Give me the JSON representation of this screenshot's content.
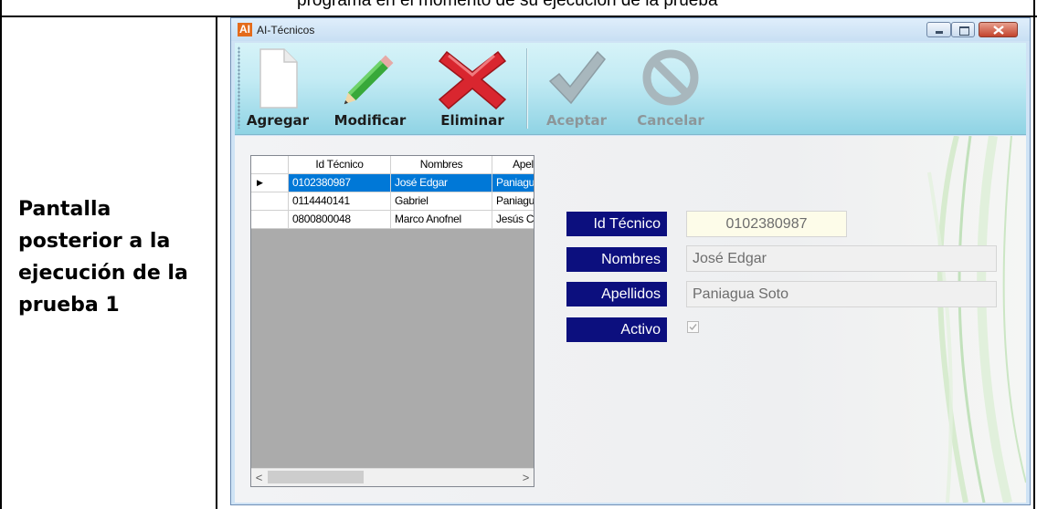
{
  "document": {
    "top_text": "programa en el momento de su ejecución de la prueba",
    "cell_label_lines": [
      "Pantalla",
      "posterior a la",
      "ejecución de la",
      "prueba 1"
    ]
  },
  "window": {
    "icon_text": "AI",
    "title": "AI-Técnicos"
  },
  "toolbar": {
    "items": [
      {
        "label": "Agregar",
        "icon": "new-document-icon",
        "enabled": true
      },
      {
        "label": "Modificar",
        "icon": "pencil-icon",
        "enabled": true
      },
      {
        "label": "Eliminar",
        "icon": "red-x-icon",
        "enabled": true
      },
      {
        "label": "Aceptar",
        "icon": "checkmark-icon",
        "enabled": false
      },
      {
        "label": "Cancelar",
        "icon": "cancel-icon",
        "enabled": false
      }
    ]
  },
  "grid": {
    "columns": [
      "Id Técnico",
      "Nombres",
      "Apellid"
    ],
    "rows": [
      {
        "cells": [
          "0102380987",
          "José Edgar",
          "Paniagu"
        ],
        "selected": true
      },
      {
        "cells": [
          "0114440141",
          "Gabriel",
          "Paniagu"
        ],
        "selected": false
      },
      {
        "cells": [
          "0800800048",
          "Marco Anofnel",
          "Jesús C"
        ],
        "selected": false
      }
    ],
    "scroll_left": "<",
    "scroll_right": ">"
  },
  "form": {
    "id_label": "Id Técnico",
    "id_value": "0102380987",
    "nombres_label": "Nombres",
    "nombres_value": "José Edgar",
    "apellidos_label": "Apellidos",
    "apellidos_value": "Paniagua Soto",
    "activo_label": "Activo",
    "activo_checked": true
  },
  "colors": {
    "label_bg": "#0c0f7e",
    "selection": "#0078d7",
    "id_field_bg": "#fdfce9",
    "disabled_field_bg": "#f0f0f0"
  }
}
